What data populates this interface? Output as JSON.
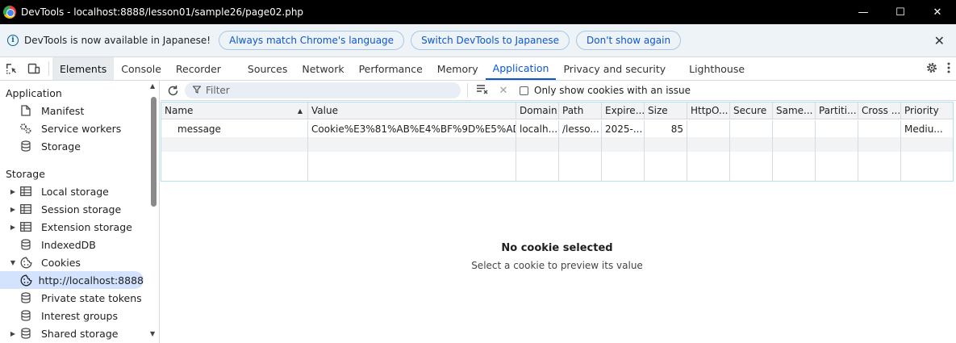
{
  "window": {
    "title": "DevTools - localhost:8888/lesson01/sample26/page02.php",
    "minimize": "—",
    "maximize": "☐",
    "close": "✕"
  },
  "infobar": {
    "message": "DevTools is now available in Japanese!",
    "buttons": [
      "Always match Chrome's language",
      "Switch DevTools to Japanese",
      "Don't show again"
    ],
    "close": "✕"
  },
  "tabs": {
    "items": [
      "Elements",
      "Console",
      "Recorder",
      "Sources",
      "Network",
      "Performance",
      "Memory",
      "Application",
      "Privacy and security",
      "Lighthouse"
    ],
    "active": "Application"
  },
  "sidebar": {
    "app_header": "Application",
    "app_items": [
      "Manifest",
      "Service workers",
      "Storage"
    ],
    "storage_header": "Storage",
    "storage_items": [
      {
        "label": "Local storage",
        "arrow": "▶"
      },
      {
        "label": "Session storage",
        "arrow": "▶"
      },
      {
        "label": "Extension storage",
        "arrow": "▶"
      },
      {
        "label": "IndexedDB",
        "arrow": ""
      },
      {
        "label": "Cookies",
        "arrow": "▼"
      }
    ],
    "cookie_origin": "http://localhost:8888",
    "after_items": [
      {
        "label": "Private state tokens",
        "arrow": ""
      },
      {
        "label": "Interest groups",
        "arrow": ""
      },
      {
        "label": "Shared storage",
        "arrow": "▶"
      }
    ]
  },
  "toolbar": {
    "filter_placeholder": "Filter",
    "only_issue_label": "Only show cookies with an issue"
  },
  "table": {
    "columns": [
      "Name",
      "Value",
      "Domain",
      "Path",
      "Expire...",
      "Size",
      "HttpO...",
      "Secure",
      "Same...",
      "Partiti...",
      "Cross ...",
      "Priority"
    ],
    "rows": [
      [
        "message",
        "Cookie%E3%81%AB%E4%BF%9D%E5%AD%...",
        "localh...",
        "/lesso...",
        "2025-...",
        "85",
        "",
        "",
        "",
        "",
        "",
        "Mediu..."
      ]
    ]
  },
  "preview": {
    "title": "No cookie selected",
    "subtitle": "Select a cookie to preview its value"
  }
}
